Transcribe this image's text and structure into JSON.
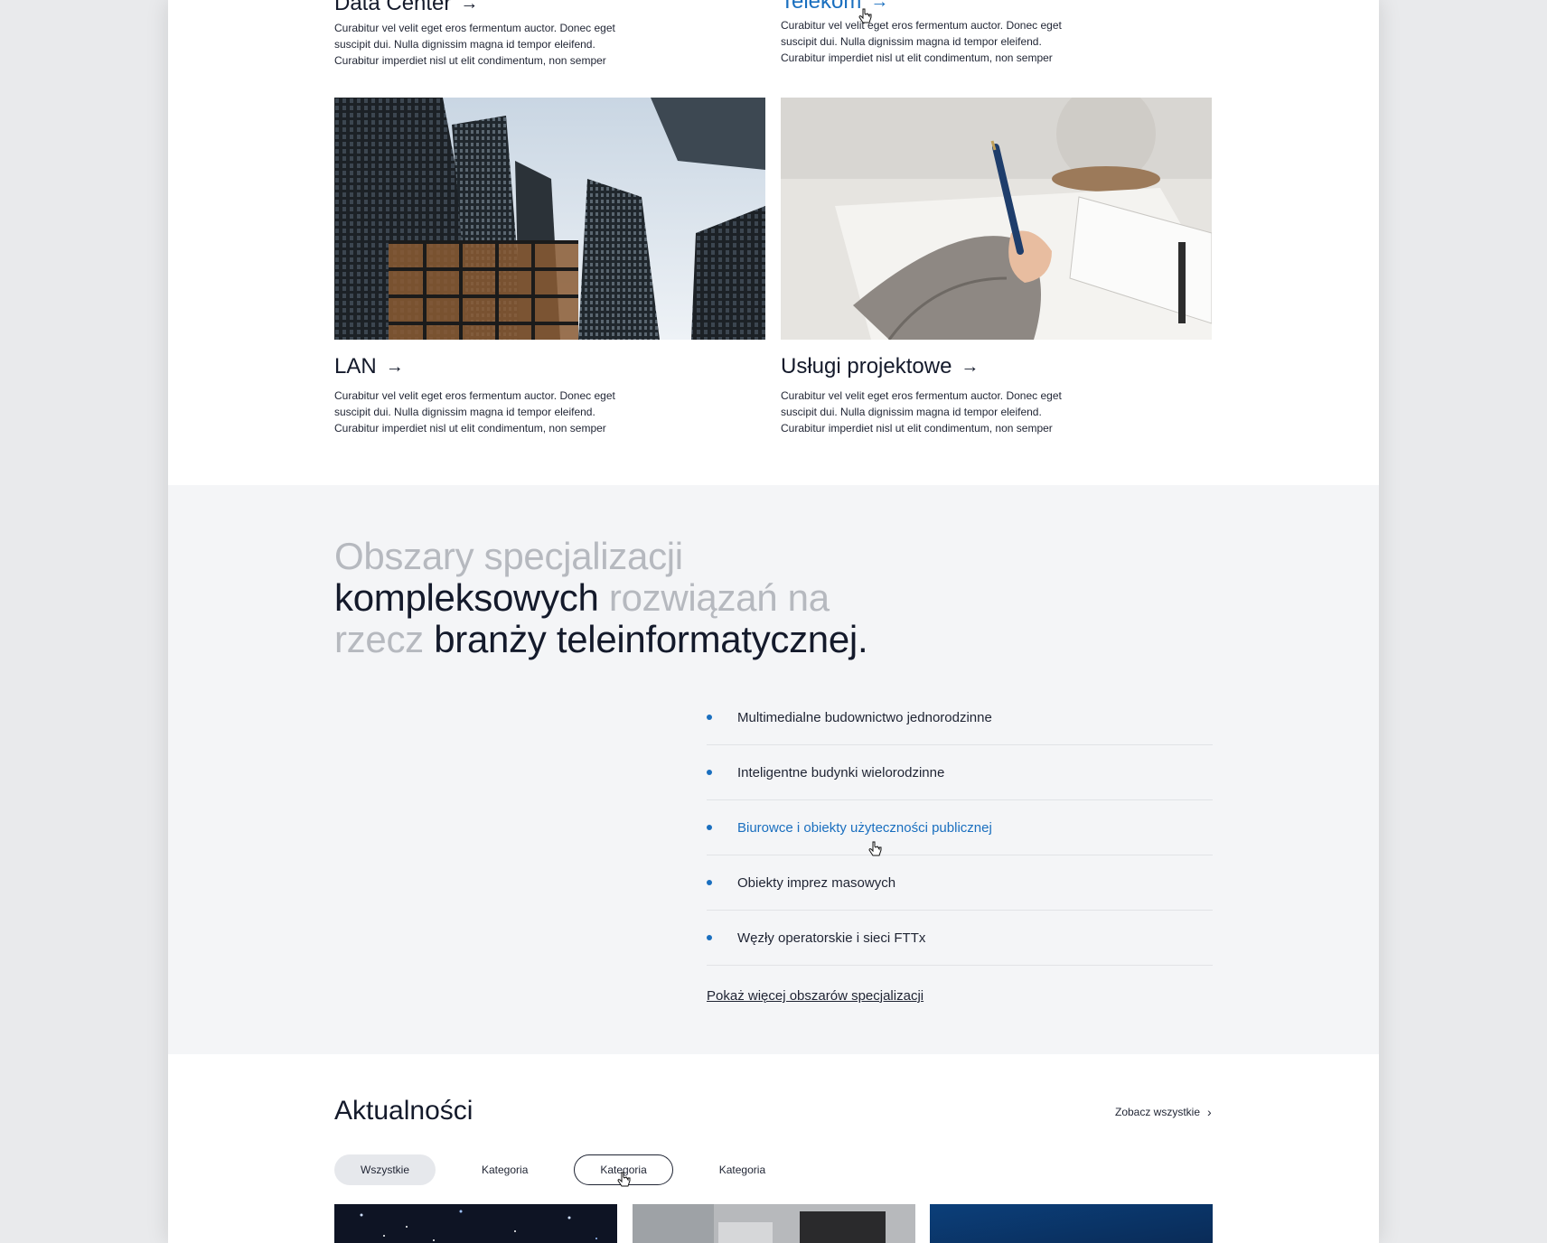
{
  "cards": [
    {
      "title": "Data Center",
      "arrow": "→",
      "desc": "Curabitur vel velit eget eros fermentum auctor. Donec eget suscipit dui. Nulla dignissim magna id tempor eleifend. Curabitur imperdiet nisl ut elit condimentum, non semper"
    },
    {
      "title": "Telekom",
      "arrow": "→",
      "desc": "Curabitur vel velit eget eros fermentum auctor. Donec eget suscipit dui. Nulla dignissim magna id tempor eleifend. Curabitur imperdiet nisl ut elit condimentum, non semper"
    },
    {
      "title": "LAN",
      "arrow": "→",
      "desc": "Curabitur vel velit eget eros fermentum auctor. Donec eget suscipit dui. Nulla dignissim magna id tempor eleifend. Curabitur imperdiet nisl ut elit condimentum, non semper"
    },
    {
      "title": "Usługi projektowe",
      "arrow": "→",
      "desc": "Curabitur vel velit eget eros fermentum auctor. Donec eget suscipit dui. Nulla dignissim magna id tempor eleifend. Curabitur imperdiet nisl ut elit condimentum, non semper"
    }
  ],
  "specialization": {
    "heading": {
      "part1": "Obszary specjalizacji",
      "part2": "kompleksowych",
      "part3": "rozwiązań na",
      "part4": "rzecz",
      "part5": "branży teleinformatycznej."
    },
    "items": [
      "Multimedialne budownictwo jednorodzinne",
      "Inteligentne budynki wielorodzinne",
      "Biurowce i obiekty użyteczności publicznej",
      "Obiekty imprez masowych",
      "Węzły operatorskie i sieci FTTx"
    ],
    "more": "Pokaż więcej obszarów specjalizacji"
  },
  "news": {
    "title": "Aktualności",
    "see_all": "Zobacz wszystkie",
    "see_all_icon": "›",
    "filters": [
      "Wszystkie",
      "Kategoria",
      "Kategoria",
      "Kategoria"
    ]
  },
  "colors": {
    "accent": "#1a6fbf",
    "text": "#141a2b",
    "muted": "#b6b9bf",
    "section_bg": "#f4f5f7"
  }
}
